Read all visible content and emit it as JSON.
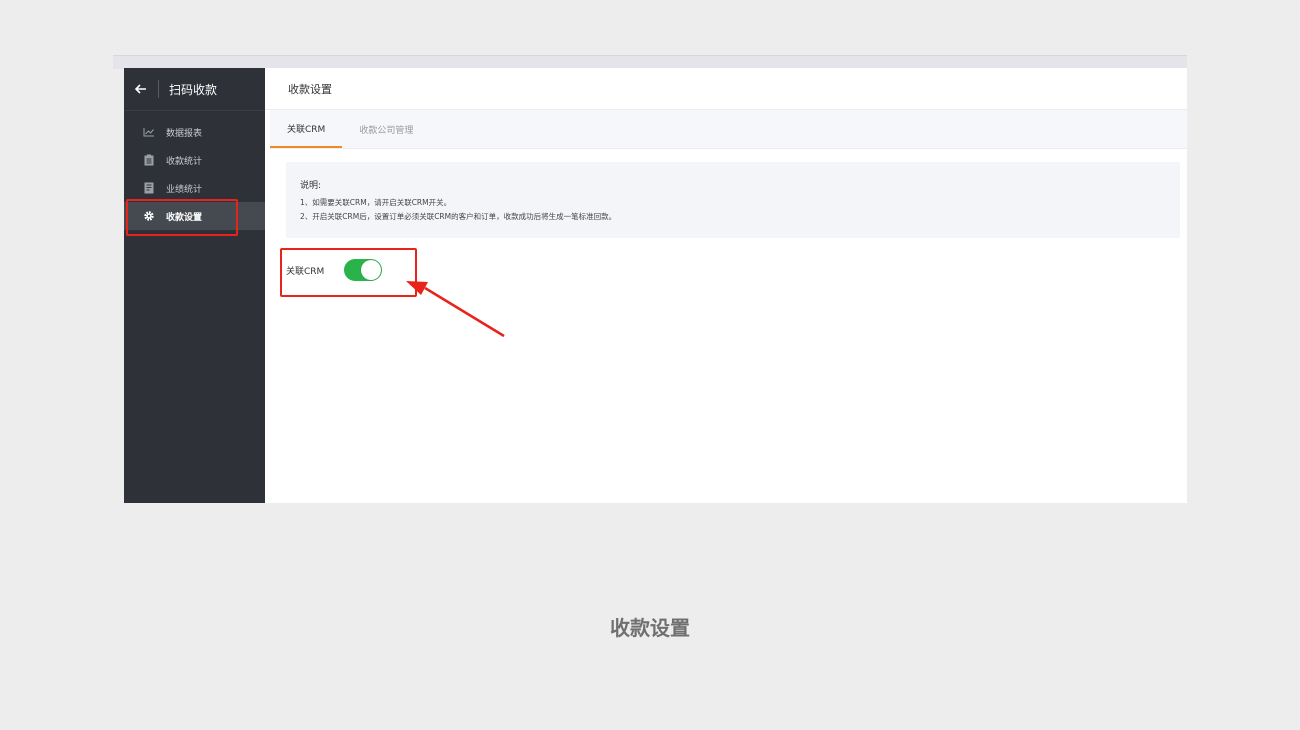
{
  "sidebar": {
    "back_icon": "arrow-left-icon",
    "title": "扫码收款",
    "items": [
      {
        "label": "数据报表",
        "icon": "chart-line-icon",
        "active": false
      },
      {
        "label": "收款统计",
        "icon": "clipboard-icon",
        "active": false
      },
      {
        "label": "业绩统计",
        "icon": "document-icon",
        "active": false
      },
      {
        "label": "收款设置",
        "icon": "gear-icon",
        "active": true
      }
    ]
  },
  "main": {
    "title": "收款设置",
    "tabs": [
      {
        "label": "关联CRM",
        "active": true
      },
      {
        "label": "收款公司管理",
        "active": false
      }
    ],
    "notice": {
      "title": "说明:",
      "lines": [
        "1、如需要关联CRM，请开启关联CRM开关。",
        "2、开启关联CRM后，设置订单必须关联CRM的客户和订单，收款成功后将生成一笔标准回款。"
      ]
    },
    "crm_toggle": {
      "label": "关联CRM",
      "on": true
    }
  },
  "colors": {
    "sidebar_bg": "#2e3138",
    "accent_tab": "#f08a24",
    "toggle_on": "#29b34a",
    "annotation": "#e8231a"
  },
  "caption": "收款设置"
}
